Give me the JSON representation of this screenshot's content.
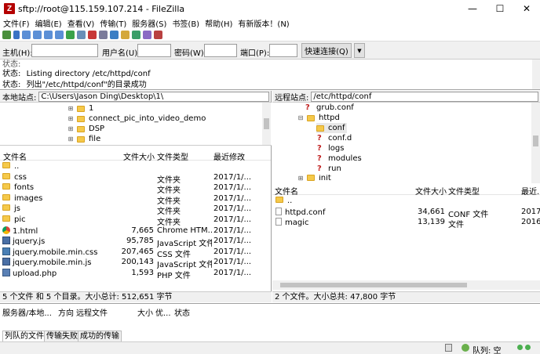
{
  "window": {
    "title": "sftp://root@115.159.107.214 - FileZilla",
    "minimize": "—",
    "maximize": "☐",
    "close": "✕"
  },
  "menu": [
    "文件(F)",
    "编辑(E)",
    "查看(V)",
    "传输(T)",
    "服务器(S)",
    "书签(B)",
    "帮助(H)",
    "有新版本！(N)"
  ],
  "quickconnect": {
    "host_label": "主机(H):",
    "user_label": "用户名(U):",
    "pass_label": "密码(W):",
    "port_label": "端口(P):",
    "host": "",
    "user": "",
    "pass": "",
    "port": "",
    "button": "快速连接(Q)",
    "dropdown": "▼"
  },
  "log": [
    {
      "label": "状态:",
      "text": "Listing directory /etc/httpd/conf"
    },
    {
      "label": "状态:",
      "text": "列出\"/etc/httpd/conf\"的目录成功"
    }
  ],
  "local": {
    "path_label": "本地站点:",
    "path": "C:\\Users\\Jason Ding\\Desktop\\1\\",
    "tree": [
      "1",
      "connect_pic_into_video_demo",
      "DSP",
      "file"
    ],
    "columns": {
      "name": "文件名",
      "size": "文件大小",
      "type": "文件类型",
      "modified": "最近修改"
    },
    "files": [
      {
        "name": "..",
        "size": "",
        "type": "",
        "modified": "",
        "icon": "folder"
      },
      {
        "name": "css",
        "size": "",
        "type": "文件夹",
        "modified": "2017/1/...",
        "icon": "folder"
      },
      {
        "name": "fonts",
        "size": "",
        "type": "文件夹",
        "modified": "2017/1/...",
        "icon": "folder"
      },
      {
        "name": "images",
        "size": "",
        "type": "文件夹",
        "modified": "2017/1/...",
        "icon": "folder"
      },
      {
        "name": "js",
        "size": "",
        "type": "文件夹",
        "modified": "2017/1/...",
        "icon": "folder"
      },
      {
        "name": "pic",
        "size": "",
        "type": "文件夹",
        "modified": "2017/1/...",
        "icon": "folder"
      },
      {
        "name": "1.html",
        "size": "7,665",
        "type": "Chrome HTM...",
        "modified": "2017/1/...",
        "icon": "chrome"
      },
      {
        "name": "jquery.js",
        "size": "95,785",
        "type": "JavaScript 文件",
        "modified": "2017/1/...",
        "icon": "js"
      },
      {
        "name": "jquery.mobile.min.css",
        "size": "207,465",
        "type": "CSS 文件",
        "modified": "2017/1/...",
        "icon": "css"
      },
      {
        "name": "jquery.mobile.min.js",
        "size": "200,143",
        "type": "JavaScript 文件",
        "modified": "2017/1/...",
        "icon": "js"
      },
      {
        "name": "upload.php",
        "size": "1,593",
        "type": "PHP 文件",
        "modified": "2017/1/...",
        "icon": "php"
      }
    ],
    "status": "5 个文件 和 5 个目录。大小总计: 512,651 字节"
  },
  "remote": {
    "path_label": "远程站点:",
    "path": "/etc/httpd/conf",
    "tree": [
      {
        "name": "grub.conf",
        "kind": "unknown",
        "level": 1
      },
      {
        "name": "httpd",
        "kind": "folder",
        "level": 1,
        "expanded": true
      },
      {
        "name": "conf",
        "kind": "folder",
        "level": 2,
        "selected": true
      },
      {
        "name": "conf.d",
        "kind": "unknown",
        "level": 2
      },
      {
        "name": "logs",
        "kind": "unknown",
        "level": 2
      },
      {
        "name": "modules",
        "kind": "unknown",
        "level": 2
      },
      {
        "name": "run",
        "kind": "unknown",
        "level": 2
      },
      {
        "name": "init",
        "kind": "folder",
        "level": 1
      }
    ],
    "columns": {
      "name": "文件名",
      "size": "文件大小",
      "type": "文件类型",
      "modified": "最近..."
    },
    "files": [
      {
        "name": "..",
        "size": "",
        "type": "",
        "modified": "",
        "icon": "folder"
      },
      {
        "name": "httpd.conf",
        "size": "34,661",
        "type": "CONF 文件",
        "modified": "2017/",
        "icon": "doc"
      },
      {
        "name": "magic",
        "size": "13,139",
        "type": "文件",
        "modified": "2016/",
        "icon": "doc"
      }
    ],
    "status": "2 个文件。大小总共: 47,800 字节"
  },
  "queue": {
    "columns": [
      "服务器/本地...",
      "方向",
      "远程文件",
      "大小",
      "优...",
      "状态"
    ],
    "tabs": [
      "列队的文件",
      "传输失败",
      "成功的传输"
    ],
    "queue_label": "队列: 空"
  }
}
